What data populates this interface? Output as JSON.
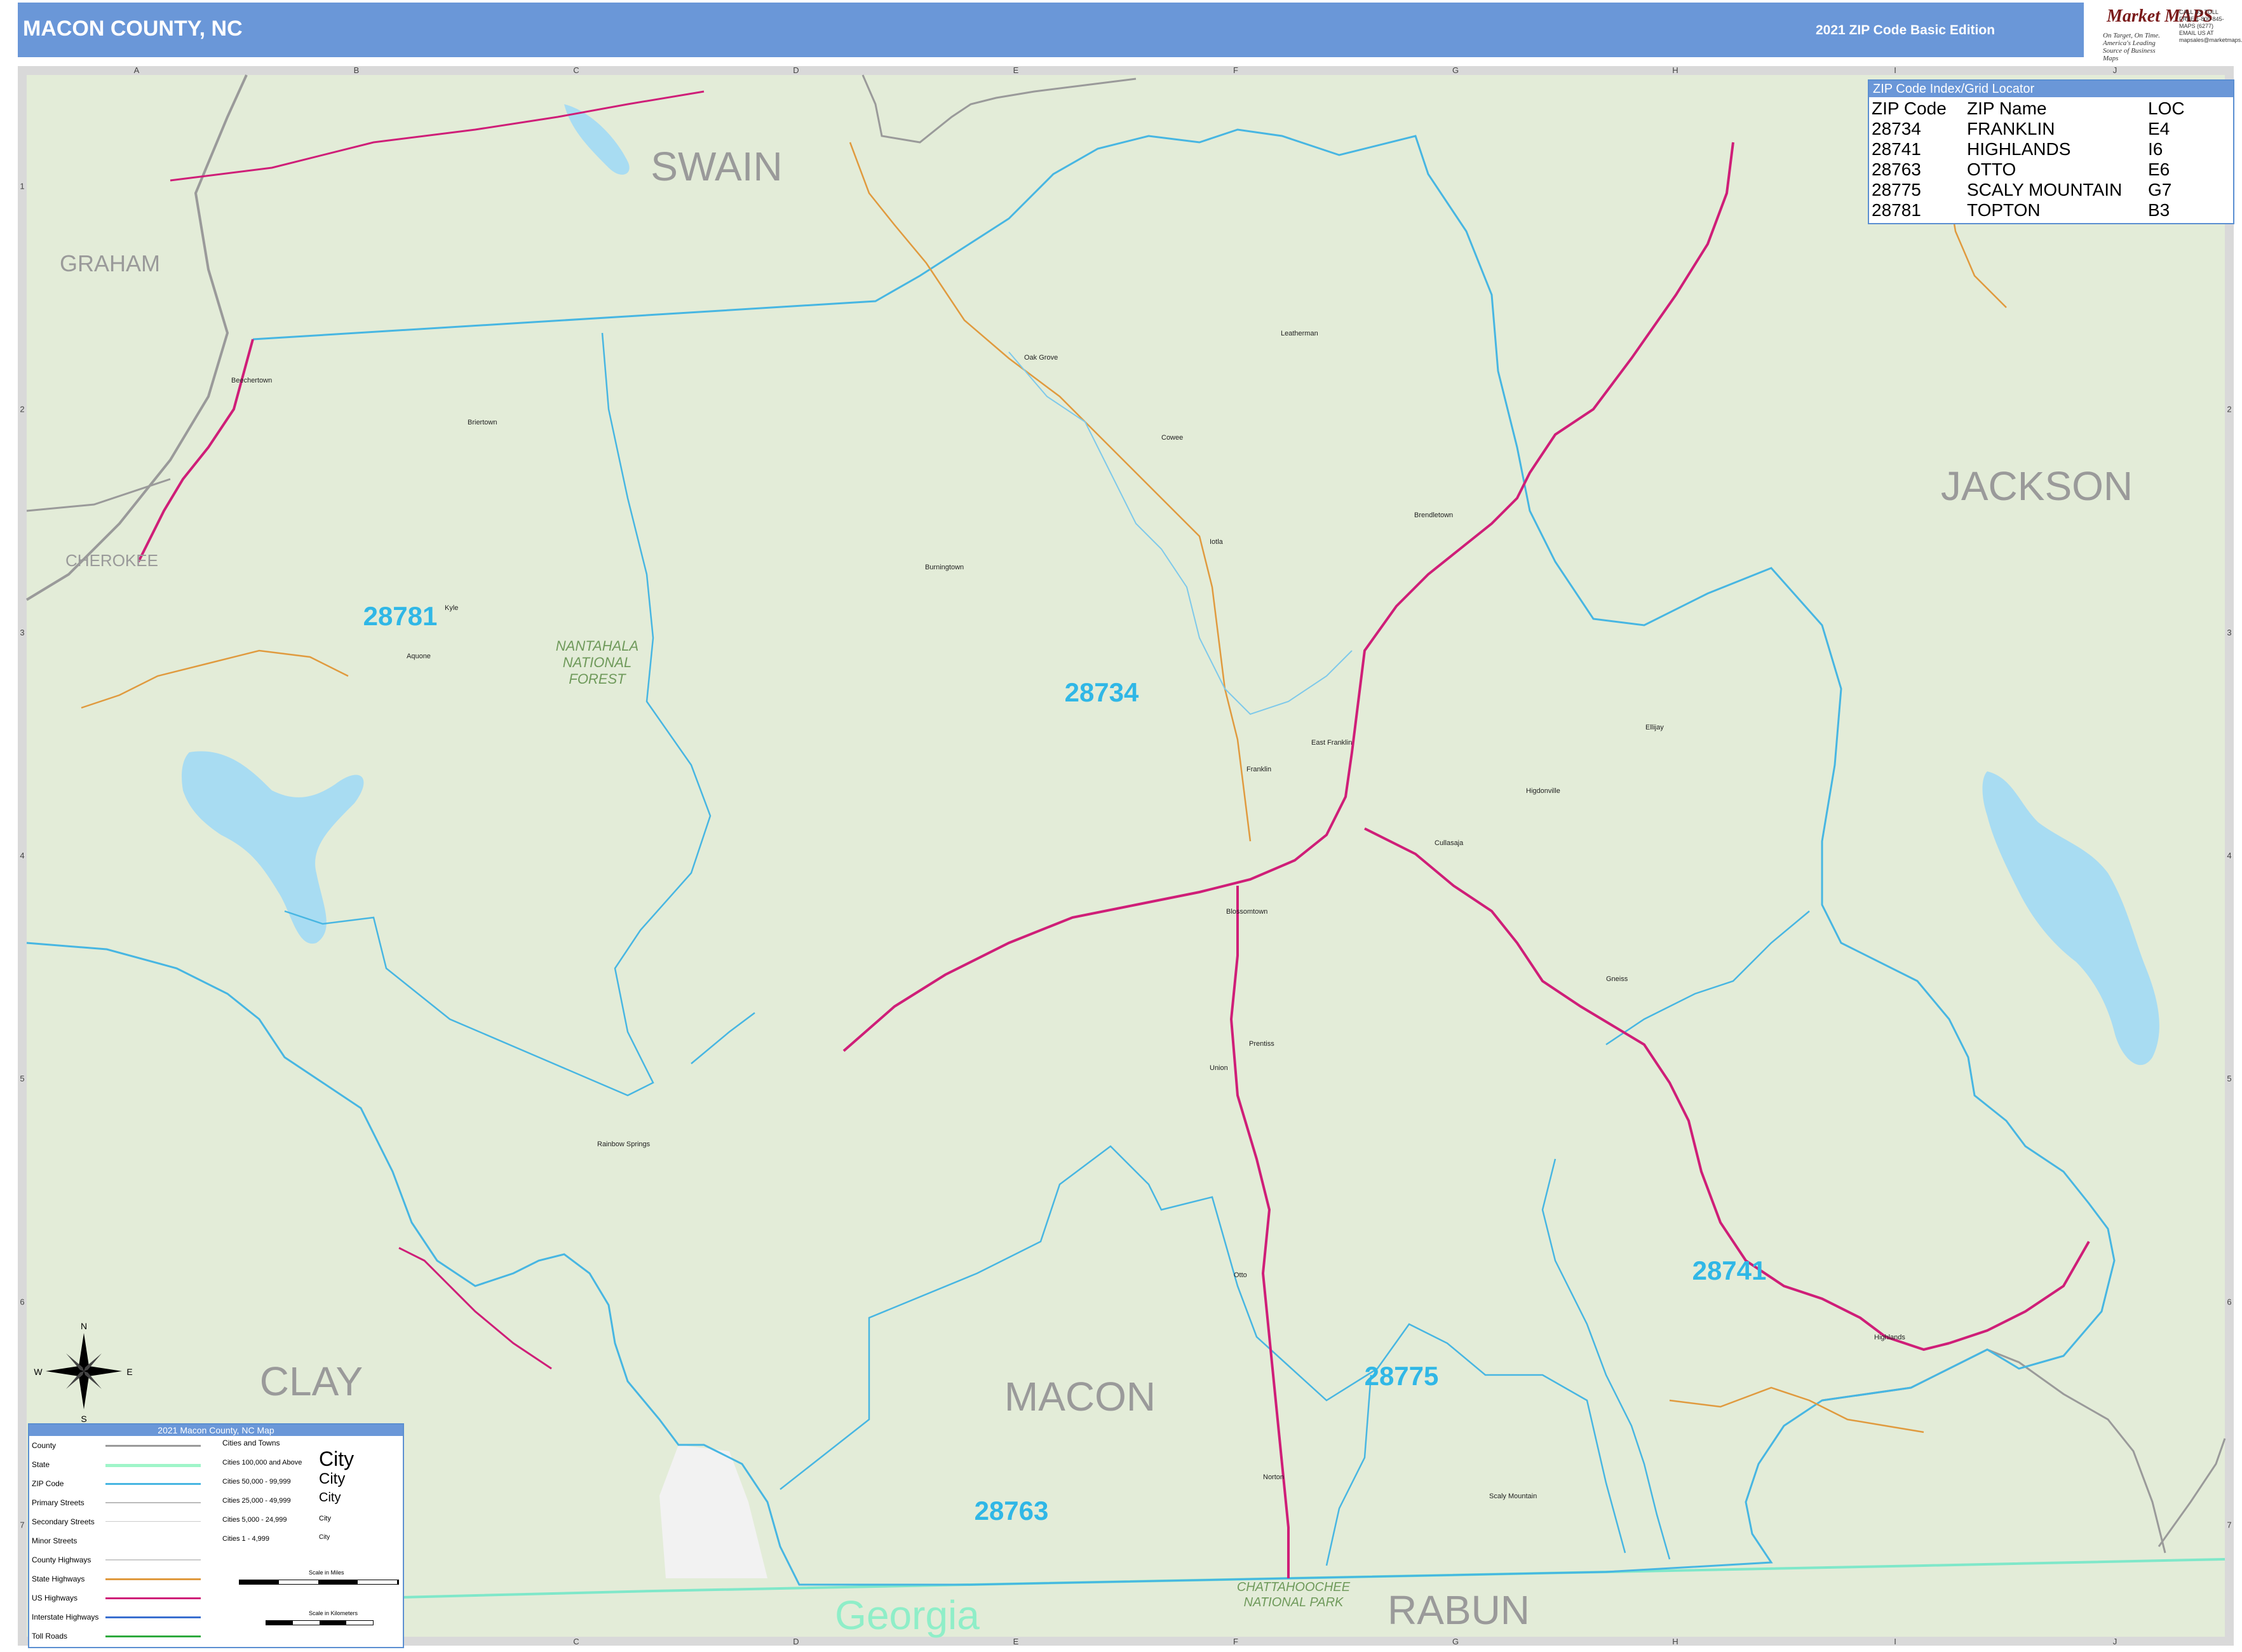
{
  "header": {
    "title": "MACON COUNTY, NC",
    "edition": "2021 ZIP Code Basic Edition",
    "logo_text": "Market MAPS",
    "logo_tagline": "On Target, On Time. America's Leading Source of Business Maps",
    "logo_contact": "CALL US TOLL FREE 1-800-845-MAPS (6277) EMAIL US AT mapsales@marketmaps.com"
  },
  "grid": {
    "columns": [
      "A",
      "B",
      "C",
      "D",
      "E",
      "F",
      "G",
      "H",
      "I",
      "J"
    ],
    "rows": [
      "1",
      "2",
      "3",
      "4",
      "5",
      "6",
      "7"
    ]
  },
  "places": {
    "swain": "SWAIN",
    "graham": "GRAHAM",
    "cherokee": "CHEROKEE",
    "jackson": "JACKSON",
    "clay": "CLAY",
    "macon": "MACON",
    "rabun": "RABUN",
    "georgia": "Georgia",
    "nantahala": "NANTAHALA NATIONAL FOREST",
    "chattahoochee": "CHATTAHOOCHEE NATIONAL PARK"
  },
  "zip_labels": {
    "z28781": "28781",
    "z28734": "28734",
    "z28741": "28741",
    "z28775": "28775",
    "z28763": "28763"
  },
  "towns": {
    "oak_grove": "Oak Grove",
    "leatherman": "Leatherman",
    "beechertown": "Beechertown",
    "briertown": "Briertown",
    "cowee": "Cowee",
    "iotla": "Iotla",
    "burningtown": "Burningtown",
    "brendletown": "Brendletown",
    "kyle": "Kyle",
    "aquone": "Aquone",
    "franklin": "Franklin",
    "east_franklin": "East Franklin",
    "ellijay": "Ellijay",
    "higdonville": "Higdonville",
    "cullasaja": "Cullasaja",
    "gneiss": "Gneiss",
    "blossomtown": "Blossomtown",
    "prentiss": "Prentiss",
    "union": "Union",
    "rainbow_springs": "Rainbow Springs",
    "otto": "Otto",
    "norton": "Norton",
    "scaly_mountain": "Scaly Mountain",
    "highlands": "Highlands"
  },
  "zip_index": {
    "title": "ZIP Code Index/Grid Locator",
    "headers": [
      "ZIP Code",
      "ZIP Name",
      "LOC"
    ],
    "rows": [
      [
        "28734",
        "FRANKLIN",
        "E4"
      ],
      [
        "28741",
        "HIGHLANDS",
        "I6"
      ],
      [
        "28763",
        "OTTO",
        "E6"
      ],
      [
        "28775",
        "SCALY MOUNTAIN",
        "G7"
      ],
      [
        "28781",
        "TOPTON",
        "B3"
      ]
    ]
  },
  "legend": {
    "title": "2021 Macon County, NC Map",
    "rows": [
      "County",
      "State",
      "ZIP Code",
      "Primary Streets",
      "Secondary Streets",
      "Minor Streets",
      "County Highways",
      "State Highways",
      "US Highways",
      "Interstate Highways",
      "Toll Roads"
    ],
    "cities_header": "Cities and Towns",
    "cities": [
      "Cities 100,000 and Above",
      "Cities 50,000 - 99,999",
      "Cities 25,000 - 49,999",
      "Cities 5,000 - 24,999",
      "Cities 1 - 4,999"
    ],
    "city_samples": [
      "City",
      "City",
      "City",
      "City",
      "City"
    ],
    "scale_miles": "Scale in Miles",
    "scale_km": "Scale in Kilometers"
  },
  "compass": {
    "n": "N",
    "s": "S",
    "e": "E",
    "w": "W"
  },
  "colors": {
    "land": "#e3ecd8",
    "outside": "#d9d9d9",
    "water": "#a8dcf2",
    "zip_boundary": "#47b6e2",
    "county_boundary": "#9a9a9a",
    "state_boundary": "#7fe7c9",
    "us_highway": "#cf1e78",
    "state_highway": "#e09a3e",
    "header": "#6a97d8"
  }
}
